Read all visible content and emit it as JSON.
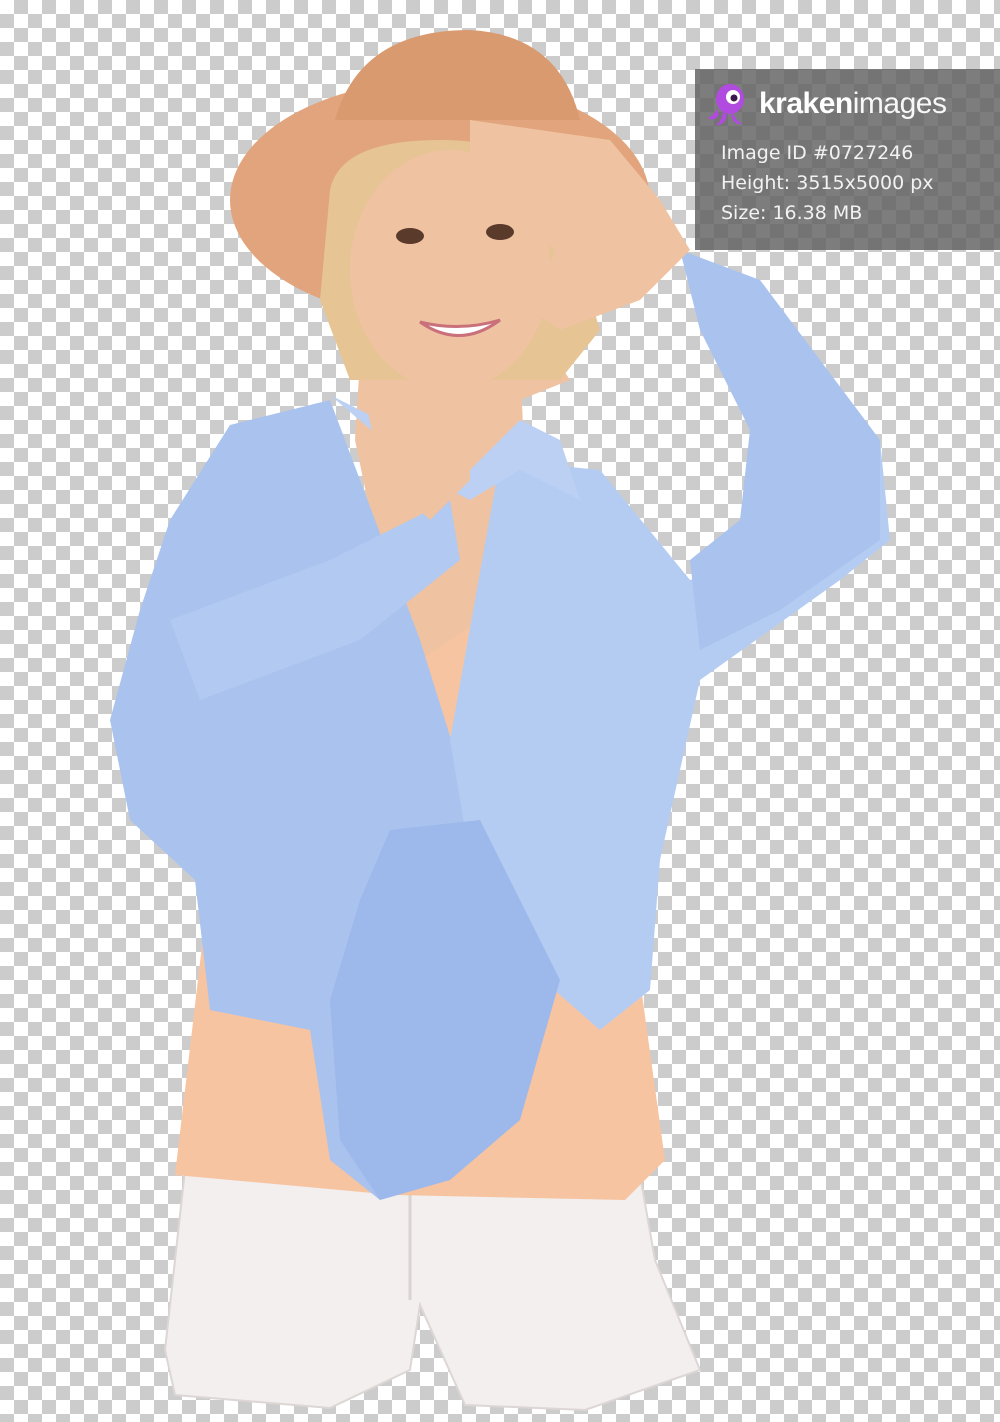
{
  "brand": {
    "name_bold": "kraken",
    "name_light": "images",
    "accent_color": "#b14be0",
    "icon": "kraken-octopus-icon"
  },
  "image_info": {
    "id_line": "Image ID #0727246",
    "height_line": "Height: 3515x5000 px",
    "size_line": "Size: 16.38 MB"
  },
  "photo": {
    "subject": "woman-in-straw-hat-framing-gesture",
    "background": "transparency-checkerboard",
    "colors": {
      "hat": "#e1a47c",
      "shirt": "#a9c2ee",
      "top": "#f7c4a2",
      "shorts": "#f2efee",
      "skin": "#efc2a1",
      "hair": "#e6c494"
    }
  }
}
